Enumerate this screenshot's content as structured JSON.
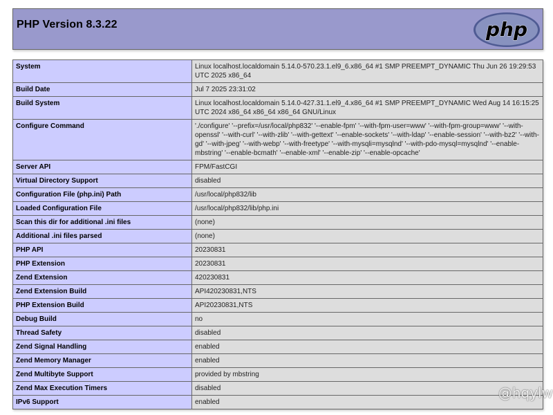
{
  "header": {
    "title": "PHP Version 8.3.22",
    "logo_text": "php"
  },
  "colors": {
    "header_bg": "#9999cc",
    "label_bg": "#ccccff",
    "value_bg": "#dddddd",
    "logo_bg": "#8892bf",
    "logo_text": "#000000"
  },
  "rows": [
    {
      "label": "System",
      "value": "Linux localhost.localdomain 5.14.0-570.23.1.el9_6.x86_64 #1 SMP PREEMPT_DYNAMIC Thu Jun 26 19:29:53 UTC 2025 x86_64"
    },
    {
      "label": "Build Date",
      "value": "Jul 7 2025 23:31:02"
    },
    {
      "label": "Build System",
      "value": "Linux localhost.localdomain 5.14.0-427.31.1.el9_4.x86_64 #1 SMP PREEMPT_DYNAMIC Wed Aug 14 16:15:25 UTC 2024 x86_64 x86_64 x86_64 GNU/Linux"
    },
    {
      "label": "Configure Command",
      "value": "'./configure' '--prefix=/usr/local/php832' '--enable-fpm' '--with-fpm-user=www' '--with-fpm-group=www' '--with-openssl' '--with-curl' '--with-zlib' '--with-gettext' '--enable-sockets' '--with-ldap' '--enable-session' '--with-bz2' '--with-gd' '--with-jpeg' '--with-webp' '--with-freetype' '--with-mysqli=mysqlnd' '--with-pdo-mysql=mysqlnd' '--enable-mbstring' '--enable-bcmath' '--enable-xml' '--enable-zip' '--enable-opcache'"
    },
    {
      "label": "Server API",
      "value": "FPM/FastCGI"
    },
    {
      "label": "Virtual Directory Support",
      "value": "disabled"
    },
    {
      "label": "Configuration File (php.ini) Path",
      "value": "/usr/local/php832/lib"
    },
    {
      "label": "Loaded Configuration File",
      "value": "/usr/local/php832/lib/php.ini"
    },
    {
      "label": "Scan this dir for additional .ini files",
      "value": "(none)"
    },
    {
      "label": "Additional .ini files parsed",
      "value": "(none)"
    },
    {
      "label": "PHP API",
      "value": "20230831"
    },
    {
      "label": "PHP Extension",
      "value": "20230831"
    },
    {
      "label": "Zend Extension",
      "value": "420230831"
    },
    {
      "label": "Zend Extension Build",
      "value": "API420230831,NTS"
    },
    {
      "label": "PHP Extension Build",
      "value": "API20230831,NTS"
    },
    {
      "label": "Debug Build",
      "value": "no"
    },
    {
      "label": "Thread Safety",
      "value": "disabled"
    },
    {
      "label": "Zend Signal Handling",
      "value": "enabled"
    },
    {
      "label": "Zend Memory Manager",
      "value": "enabled"
    },
    {
      "label": "Zend Multibyte Support",
      "value": "provided by mbstring"
    },
    {
      "label": "Zend Max Execution Timers",
      "value": "disabled"
    },
    {
      "label": "IPv6 Support",
      "value": "enabled"
    }
  ],
  "watermark": "@hqylw"
}
